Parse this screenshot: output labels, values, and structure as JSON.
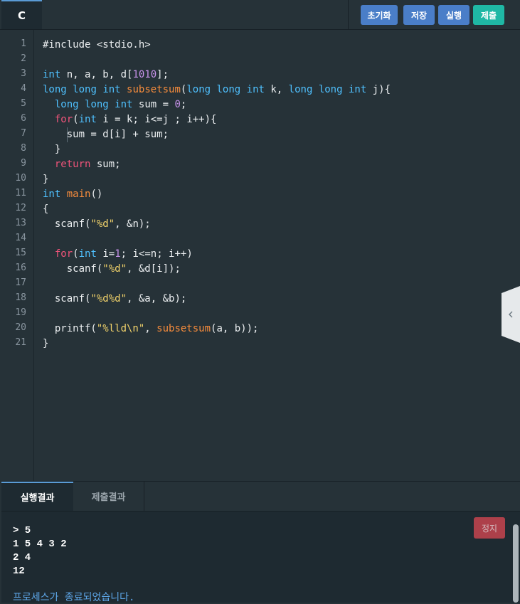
{
  "editor": {
    "language_tab": "C",
    "toolbar": {
      "reset": "초기화",
      "save": "저장",
      "run": "실행",
      "submit": "제출"
    },
    "line_numbers": [
      "1",
      "2",
      "3",
      "4",
      "5",
      "6",
      "7",
      "8",
      "9",
      "10",
      "11",
      "12",
      "13",
      "14",
      "15",
      "16",
      "17",
      "18",
      "19",
      "20",
      "21"
    ],
    "lines": [
      "#include <stdio.h>",
      "",
      "int n, a, b, d[1010];",
      "long long int subsetsum(long long int k, long long int j){",
      "  long long int sum = 0;",
      "  for(int i = k; i<=j ; i++){",
      "    sum = d[i] + sum;",
      "  }",
      "  return sum;",
      "}",
      "int main()",
      "{",
      "  scanf(\"%d\", &n);",
      "",
      "  for(int i=1; i<=n; i++)",
      "    scanf(\"%d\", &d[i]);",
      "",
      "  scanf(\"%d%d\", &a, &b);",
      "",
      "  printf(\"%lld\\n\", subsetsum(a, b));",
      "}"
    ]
  },
  "results": {
    "tabs": {
      "run_result": "실행결과",
      "submit_result": "제출결과"
    },
    "stop_button": "정지",
    "output": [
      "> 5",
      "1 5 4 3 2",
      "2 4",
      "12"
    ],
    "process_status": "프로세스가 종료되었습니다."
  },
  "icons": {
    "collapse": "chevron-left-icon"
  },
  "colors": {
    "accent_blue": "#4a7ec8",
    "accent_teal": "#1fb8a5",
    "stop_red": "#c6454f"
  }
}
